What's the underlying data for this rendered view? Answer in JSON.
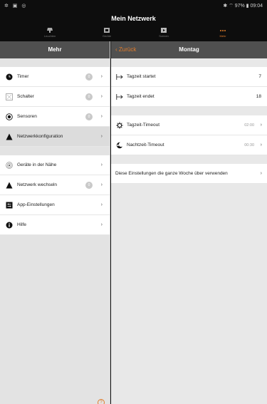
{
  "status": {
    "left": "✲ ▣ ◎",
    "right": "✱ ⌔ 97% ▮ 09:04"
  },
  "app": {
    "title": "Mein Netzwerk"
  },
  "tabs": [
    {
      "label": "Leuchten",
      "icon": "lamp-icon"
    },
    {
      "label": "Geräte",
      "icon": "device-icon"
    },
    {
      "label": "Szenen",
      "icon": "scene-icon"
    },
    {
      "label": "Mehr",
      "icon": "more-icon",
      "active": true
    }
  ],
  "left": {
    "title": "Mehr",
    "group1": [
      {
        "label": "Timer",
        "icon": "clock-icon",
        "badge": "0",
        "chevron": "›"
      },
      {
        "label": "Schalter",
        "icon": "switch-icon",
        "badge": "0",
        "chevron": "›"
      },
      {
        "label": "Sensoren",
        "icon": "sensor-icon",
        "badge": "0",
        "chevron": "›"
      },
      {
        "label": "Netzwerkkonfiguration",
        "icon": "network-icon",
        "chevron": "›"
      }
    ],
    "group2": [
      {
        "label": "Geräte in der Nähe",
        "icon": "nearby-icon",
        "chevron": "›"
      },
      {
        "label": "Netzwerk wechseln",
        "icon": "network-switch-icon",
        "badge": "0",
        "chevron": "›"
      },
      {
        "label": "App-Einstellungen",
        "icon": "settings-icon",
        "chevron": "›"
      },
      {
        "label": "Hilfe",
        "icon": "info-icon",
        "chevron": "›"
      }
    ],
    "help_glyph": "?"
  },
  "right": {
    "back_label": "‹ Zurück",
    "title": "Montag",
    "day": [
      {
        "label": "Tagzeit startet",
        "value": "7",
        "icon": "arrow-right-bar-icon"
      },
      {
        "label": "Tagzeit endet",
        "value": "18",
        "icon": "arrow-right-bar-icon"
      }
    ],
    "timeouts": [
      {
        "label": "Tagzeit-Timeout",
        "value": "02:00",
        "icon": "sun-icon",
        "chevron": "›"
      },
      {
        "label": "Nachtzeit-Timeout",
        "value": "00:30",
        "icon": "moon-icon",
        "chevron": "›"
      }
    ],
    "apply_all": {
      "label": "Diese Einstellungen die ganze Woche über verwenden",
      "chevron": "›"
    }
  },
  "colors": {
    "accent": "#e07b2a",
    "header": "#505050",
    "topbar": "#0d0d0d"
  }
}
